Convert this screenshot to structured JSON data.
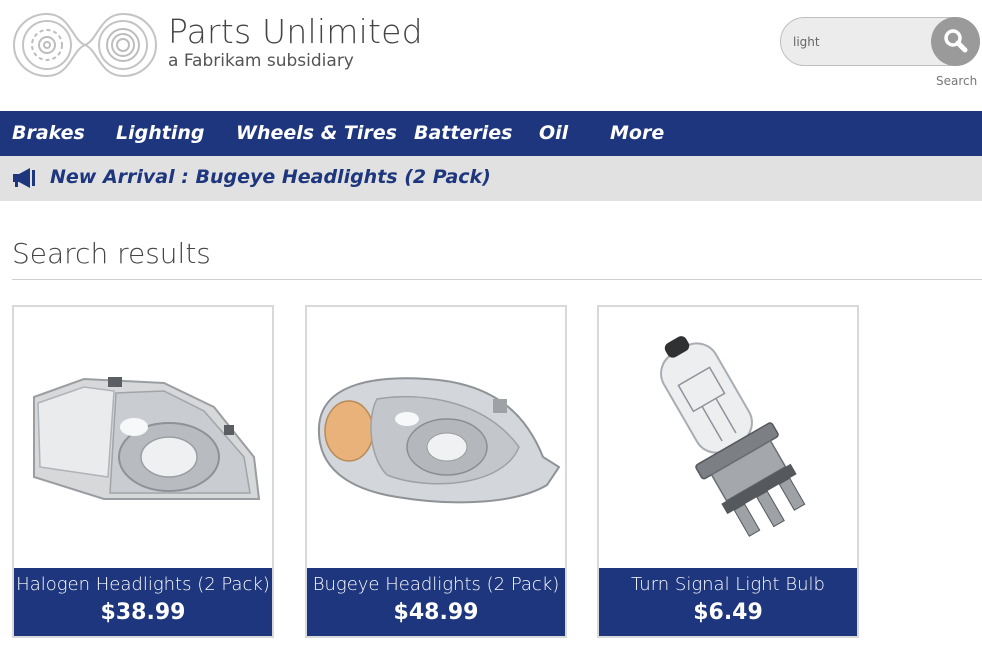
{
  "brand": {
    "title": "Parts Unlimited",
    "subtitle": "a Fabrikam subsidiary"
  },
  "search": {
    "value": "light",
    "button_label": "Search",
    "icon": "search-icon"
  },
  "nav": {
    "items": [
      {
        "label": "Brakes"
      },
      {
        "label": "Lighting"
      },
      {
        "label": "Wheels & Tires"
      },
      {
        "label": "Batteries"
      },
      {
        "label": "Oil"
      },
      {
        "label": "More"
      }
    ]
  },
  "announcement": {
    "icon": "megaphone-icon",
    "text": "New Arrival : Bugeye Headlights (2 Pack)"
  },
  "main": {
    "title": "Search results",
    "products": [
      {
        "name": "Halogen Headlights (2 Pack)",
        "price": "$38.99"
      },
      {
        "name": "Bugeye Headlights (2 Pack)",
        "price": "$48.99"
      },
      {
        "name": "Turn Signal Light Bulb",
        "price": "$6.49"
      }
    ]
  },
  "colors": {
    "nav_bg": "#1d367d",
    "announce_bg": "#e1e1e1",
    "search_button": "#9a9a9a"
  }
}
